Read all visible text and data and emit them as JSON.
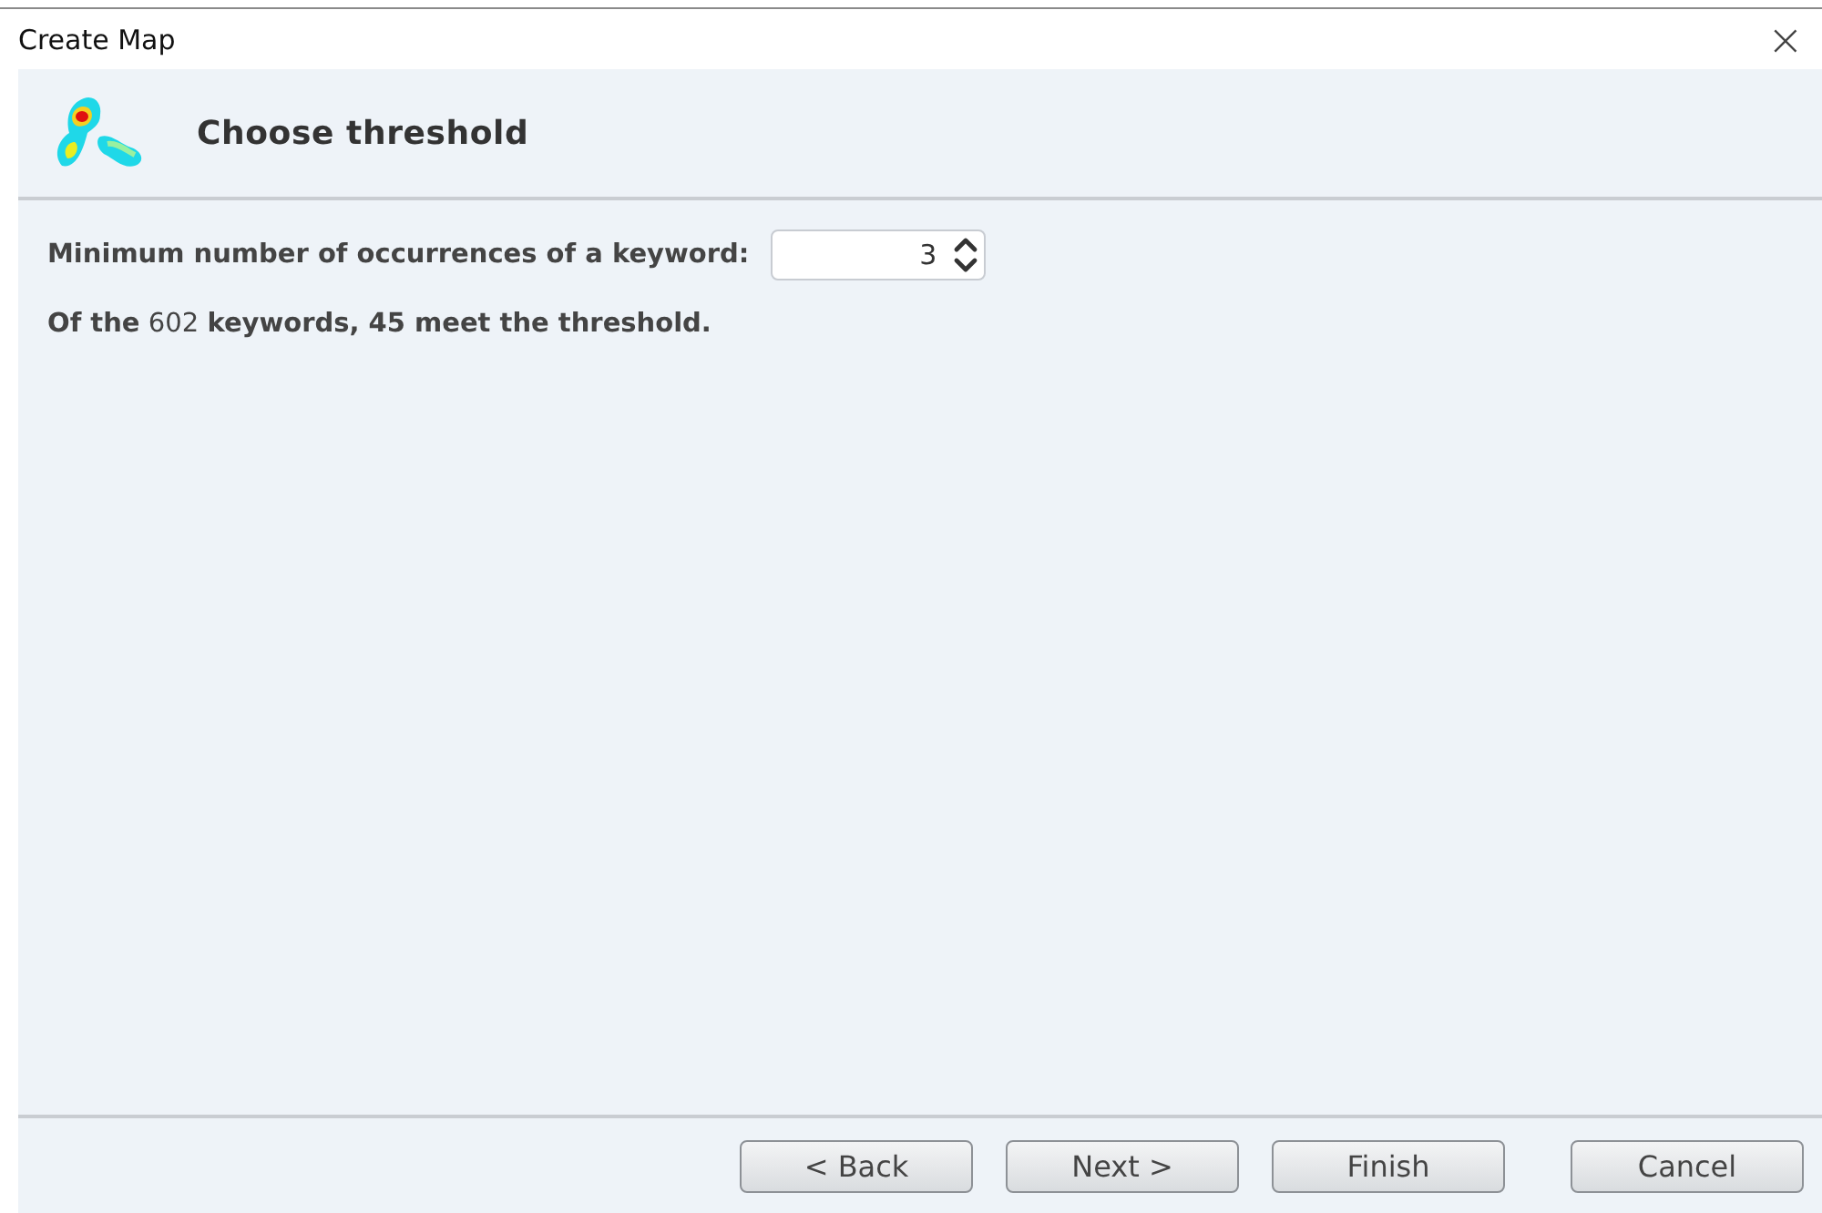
{
  "window": {
    "title": "Create Map",
    "close": "×"
  },
  "header": {
    "title": "Choose threshold"
  },
  "threshold": {
    "label": "Minimum number of occurrences of a keyword:",
    "value": "3"
  },
  "summary": "**Of the** 602 **keywords, 45 meet the threshold.**",
  "buttons": [
    {
      "label": "< Back"
    },
    {
      "label": "Next >"
    },
    {
      "label": "Finish"
    },
    {
      "label": "Cancel"
    }
  ]
}
